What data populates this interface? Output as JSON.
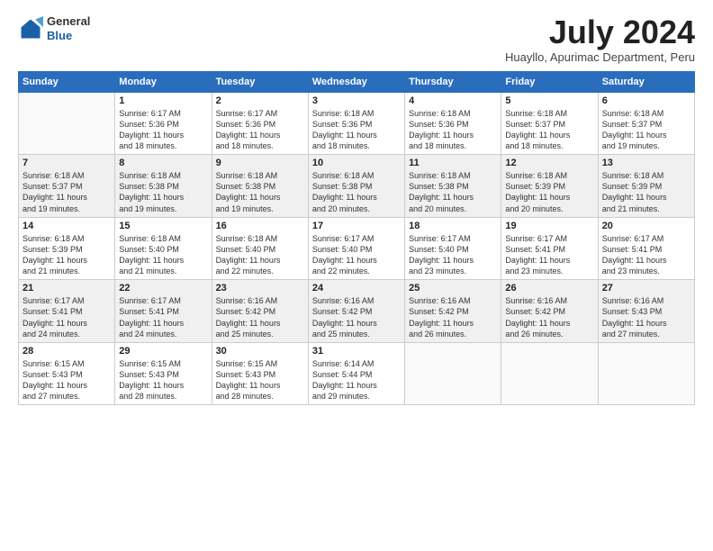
{
  "logo": {
    "general": "General",
    "blue": "Blue"
  },
  "header": {
    "month_year": "July 2024",
    "location": "Huayllo, Apurimac Department, Peru"
  },
  "weekdays": [
    "Sunday",
    "Monday",
    "Tuesday",
    "Wednesday",
    "Thursday",
    "Friday",
    "Saturday"
  ],
  "weeks": [
    [
      {
        "day": "",
        "info": ""
      },
      {
        "day": "1",
        "info": "Sunrise: 6:17 AM\nSunset: 5:36 PM\nDaylight: 11 hours\nand 18 minutes."
      },
      {
        "day": "2",
        "info": "Sunrise: 6:17 AM\nSunset: 5:36 PM\nDaylight: 11 hours\nand 18 minutes."
      },
      {
        "day": "3",
        "info": "Sunrise: 6:18 AM\nSunset: 5:36 PM\nDaylight: 11 hours\nand 18 minutes."
      },
      {
        "day": "4",
        "info": "Sunrise: 6:18 AM\nSunset: 5:36 PM\nDaylight: 11 hours\nand 18 minutes."
      },
      {
        "day": "5",
        "info": "Sunrise: 6:18 AM\nSunset: 5:37 PM\nDaylight: 11 hours\nand 18 minutes."
      },
      {
        "day": "6",
        "info": "Sunrise: 6:18 AM\nSunset: 5:37 PM\nDaylight: 11 hours\nand 19 minutes."
      }
    ],
    [
      {
        "day": "7",
        "info": "Sunrise: 6:18 AM\nSunset: 5:37 PM\nDaylight: 11 hours\nand 19 minutes."
      },
      {
        "day": "8",
        "info": "Sunrise: 6:18 AM\nSunset: 5:38 PM\nDaylight: 11 hours\nand 19 minutes."
      },
      {
        "day": "9",
        "info": "Sunrise: 6:18 AM\nSunset: 5:38 PM\nDaylight: 11 hours\nand 19 minutes."
      },
      {
        "day": "10",
        "info": "Sunrise: 6:18 AM\nSunset: 5:38 PM\nDaylight: 11 hours\nand 20 minutes."
      },
      {
        "day": "11",
        "info": "Sunrise: 6:18 AM\nSunset: 5:38 PM\nDaylight: 11 hours\nand 20 minutes."
      },
      {
        "day": "12",
        "info": "Sunrise: 6:18 AM\nSunset: 5:39 PM\nDaylight: 11 hours\nand 20 minutes."
      },
      {
        "day": "13",
        "info": "Sunrise: 6:18 AM\nSunset: 5:39 PM\nDaylight: 11 hours\nand 21 minutes."
      }
    ],
    [
      {
        "day": "14",
        "info": "Sunrise: 6:18 AM\nSunset: 5:39 PM\nDaylight: 11 hours\nand 21 minutes."
      },
      {
        "day": "15",
        "info": "Sunrise: 6:18 AM\nSunset: 5:40 PM\nDaylight: 11 hours\nand 21 minutes."
      },
      {
        "day": "16",
        "info": "Sunrise: 6:18 AM\nSunset: 5:40 PM\nDaylight: 11 hours\nand 22 minutes."
      },
      {
        "day": "17",
        "info": "Sunrise: 6:17 AM\nSunset: 5:40 PM\nDaylight: 11 hours\nand 22 minutes."
      },
      {
        "day": "18",
        "info": "Sunrise: 6:17 AM\nSunset: 5:40 PM\nDaylight: 11 hours\nand 23 minutes."
      },
      {
        "day": "19",
        "info": "Sunrise: 6:17 AM\nSunset: 5:41 PM\nDaylight: 11 hours\nand 23 minutes."
      },
      {
        "day": "20",
        "info": "Sunrise: 6:17 AM\nSunset: 5:41 PM\nDaylight: 11 hours\nand 23 minutes."
      }
    ],
    [
      {
        "day": "21",
        "info": "Sunrise: 6:17 AM\nSunset: 5:41 PM\nDaylight: 11 hours\nand 24 minutes."
      },
      {
        "day": "22",
        "info": "Sunrise: 6:17 AM\nSunset: 5:41 PM\nDaylight: 11 hours\nand 24 minutes."
      },
      {
        "day": "23",
        "info": "Sunrise: 6:16 AM\nSunset: 5:42 PM\nDaylight: 11 hours\nand 25 minutes."
      },
      {
        "day": "24",
        "info": "Sunrise: 6:16 AM\nSunset: 5:42 PM\nDaylight: 11 hours\nand 25 minutes."
      },
      {
        "day": "25",
        "info": "Sunrise: 6:16 AM\nSunset: 5:42 PM\nDaylight: 11 hours\nand 26 minutes."
      },
      {
        "day": "26",
        "info": "Sunrise: 6:16 AM\nSunset: 5:42 PM\nDaylight: 11 hours\nand 26 minutes."
      },
      {
        "day": "27",
        "info": "Sunrise: 6:16 AM\nSunset: 5:43 PM\nDaylight: 11 hours\nand 27 minutes."
      }
    ],
    [
      {
        "day": "28",
        "info": "Sunrise: 6:15 AM\nSunset: 5:43 PM\nDaylight: 11 hours\nand 27 minutes."
      },
      {
        "day": "29",
        "info": "Sunrise: 6:15 AM\nSunset: 5:43 PM\nDaylight: 11 hours\nand 28 minutes."
      },
      {
        "day": "30",
        "info": "Sunrise: 6:15 AM\nSunset: 5:43 PM\nDaylight: 11 hours\nand 28 minutes."
      },
      {
        "day": "31",
        "info": "Sunrise: 6:14 AM\nSunset: 5:44 PM\nDaylight: 11 hours\nand 29 minutes."
      },
      {
        "day": "",
        "info": ""
      },
      {
        "day": "",
        "info": ""
      },
      {
        "day": "",
        "info": ""
      }
    ]
  ]
}
